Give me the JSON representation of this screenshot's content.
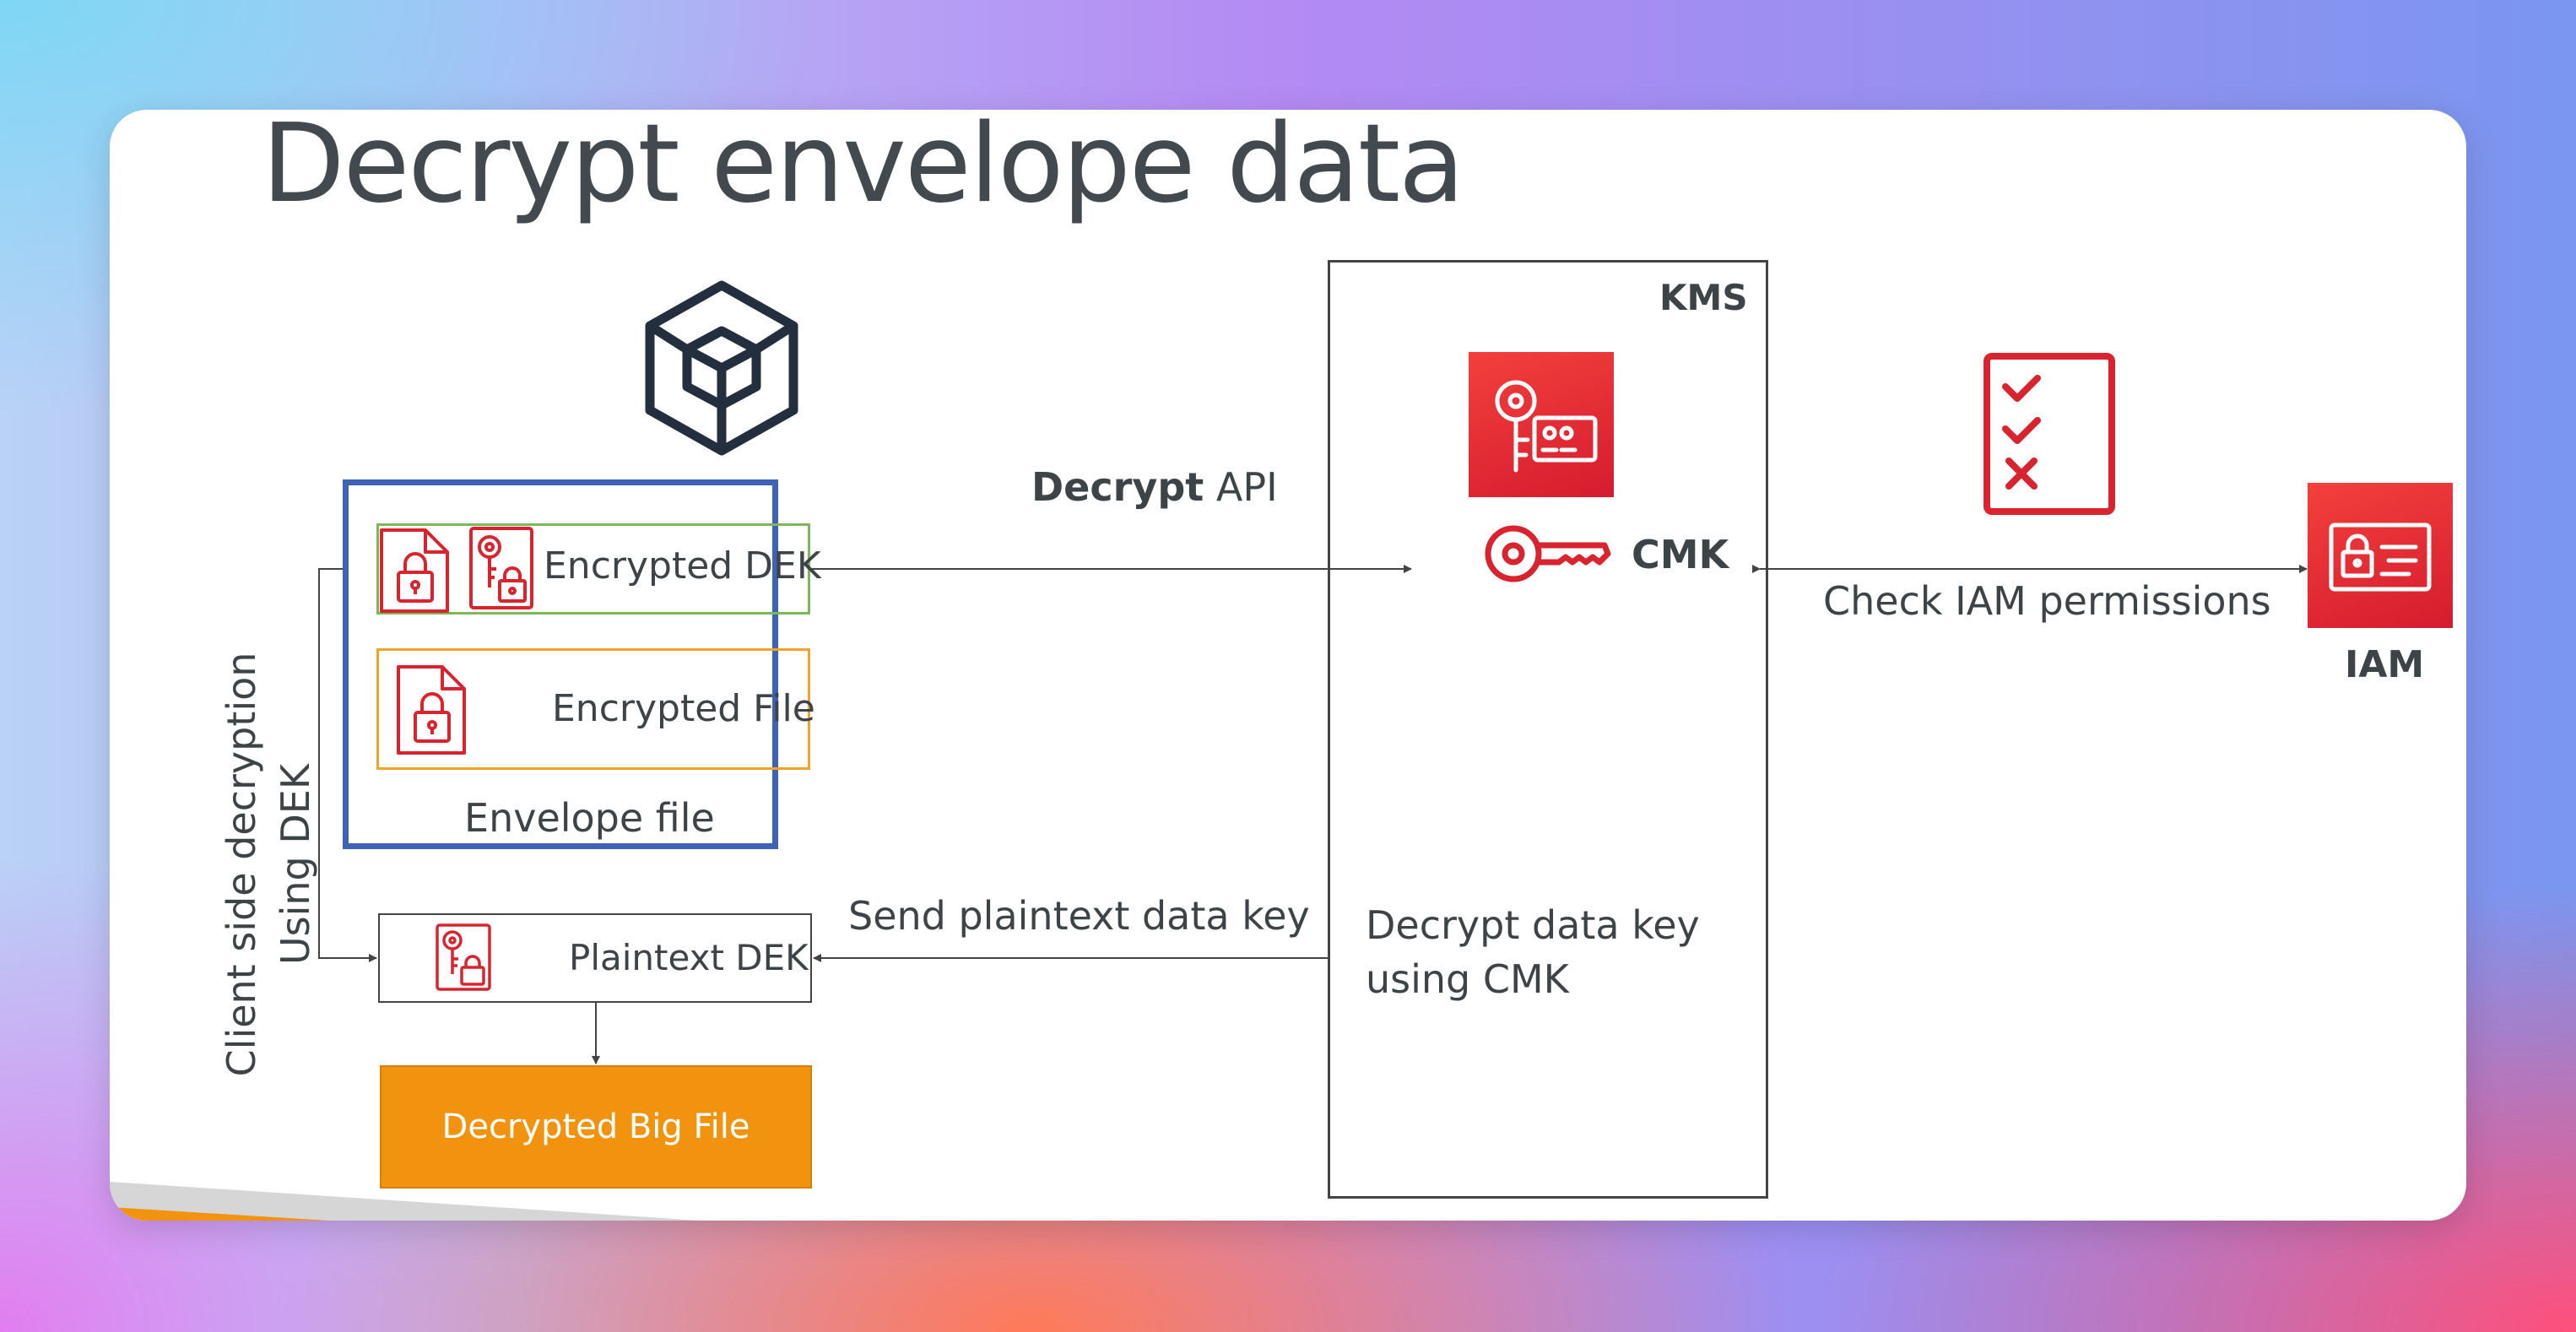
{
  "title": "Decrypt envelope data",
  "labels": {
    "encrypted_dek": "Encrypted DEK",
    "encrypted_file": "Encrypted File",
    "envelope_file": "Envelope file",
    "plaintext_dek": "Plaintext DEK",
    "decrypted_big_file": "Decrypted Big File",
    "decrypt_bold": "Decrypt",
    "decrypt_api": "API",
    "send_plaintext": "Send plaintext data key",
    "decrypt_data_key_line1": "Decrypt data key",
    "decrypt_data_key_line2": "using CMK",
    "kms": "KMS",
    "cmk": "CMK",
    "check_iam": "Check IAM permissions",
    "iam": "IAM",
    "client_side_line1": "Client side decryption",
    "client_side_line2": "Using DEK"
  },
  "colors": {
    "envelope_border": "#3e63b6",
    "dek_border": "#7cb85a",
    "file_border": "#f0a42a",
    "decrypted_fill": "#f2930f",
    "aws_red": "#e0242f",
    "text": "#3d4448"
  },
  "icons": [
    "cube-icon",
    "document-lock-icon",
    "key-lock-icon",
    "kms-key-icon",
    "key-icon",
    "checklist-icon",
    "iam-icon"
  ]
}
